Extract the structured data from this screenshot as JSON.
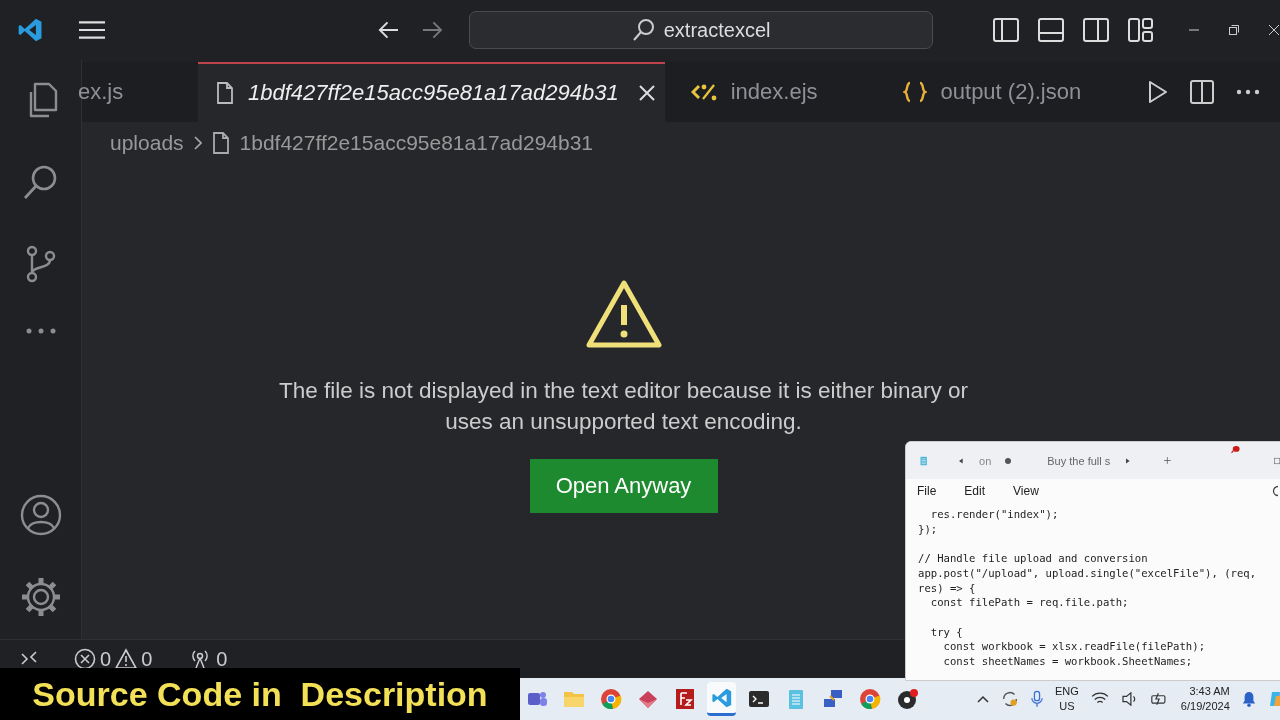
{
  "title_bar": {
    "search": "extractexcel"
  },
  "tabs": [
    {
      "label": "ex.js",
      "kind": "none",
      "selected": false,
      "preview": false
    },
    {
      "label": "1bdf427ff2e15acc95e81a17ad294b31",
      "kind": "file",
      "selected": true,
      "preview": true
    },
    {
      "label": "index.ejs",
      "kind": "ejs",
      "selected": false,
      "preview": false
    },
    {
      "label": "output (2).json",
      "kind": "json",
      "selected": false,
      "preview": false
    }
  ],
  "breadcrumb": {
    "folder": "uploads",
    "file": "1bdf427ff2e15acc95e81a17ad294b31"
  },
  "editor": {
    "message_lines": [
      "The file is not displayed in the text editor because it is either binary or",
      "uses an unsupported text encoding."
    ],
    "button": "Open Anyway"
  },
  "status_bar": {
    "errors": "0",
    "warnings": "0",
    "ports": "0"
  },
  "notepad": {
    "tabs": [
      {
        "label": "on",
        "modified": true,
        "selected": true
      },
      {
        "label": "Buy the full s",
        "modified": false,
        "selected": false
      }
    ],
    "menu": [
      "File",
      "Edit",
      "View"
    ],
    "code_blocks": [
      [
        "  res.render(\"index\");",
        "});"
      ],
      [
        "// Handle file upload and conversion",
        "app.post(\"/upload\", upload.single(\"excelFile\"), (req,",
        "res) => {",
        "  const filePath = req.file.path;"
      ],
      [
        "  try {",
        "    const workbook = xlsx.readFile(filePath);",
        "    const sheetNames = workbook.SheetNames;"
      ]
    ]
  },
  "taskbar": {
    "apps": [
      {
        "kind": "teams",
        "selected": false
      },
      {
        "kind": "folder",
        "selected": false
      },
      {
        "kind": "chrome",
        "selected": false
      },
      {
        "kind": "diamond",
        "selected": false
      },
      {
        "kind": "ftp",
        "selected": false
      },
      {
        "kind": "vscode",
        "selected": true
      },
      {
        "kind": "terminal",
        "selected": false
      },
      {
        "kind": "notepad",
        "selected": false
      },
      {
        "kind": "network",
        "selected": false
      },
      {
        "kind": "chrome",
        "selected": false
      },
      {
        "kind": "recorder",
        "selected": false
      }
    ],
    "language": [
      "ENG",
      "US"
    ],
    "time": "3:43 AM",
    "date": "6/19/2024"
  },
  "banner": "Source Code in  Description"
}
